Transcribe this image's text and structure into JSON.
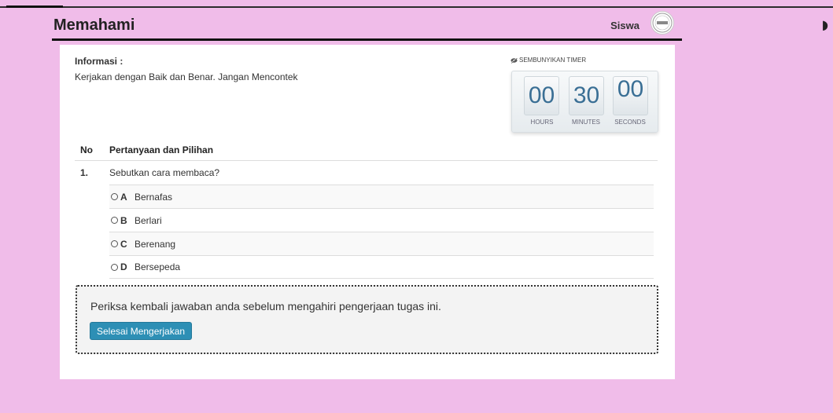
{
  "header": {
    "title": "Memahami",
    "user": "Siswa",
    "right_glyph": "›"
  },
  "info": {
    "title": "Informasi :",
    "text": "Kerjakan dengan Baik dan Benar. Jangan Mencontek"
  },
  "timer": {
    "hide_label": "SEMBUNYIKAN TIMER",
    "hours": "00",
    "minutes": "30",
    "seconds": "00",
    "hours_label": "HOURS",
    "minutes_label": "MINUTES",
    "seconds_label": "SECONDS"
  },
  "table": {
    "col_no": "No",
    "col_question": "Pertanyaan dan Pilihan"
  },
  "question": {
    "number": "1.",
    "text": "Sebutkan cara membaca?",
    "options": [
      {
        "letter": "A",
        "text": "Bernafas"
      },
      {
        "letter": "B",
        "text": "Berlari"
      },
      {
        "letter": "C",
        "text": "Berenang"
      },
      {
        "letter": "D",
        "text": "Bersepeda"
      }
    ]
  },
  "notice": {
    "text": "Periksa kembali jawaban anda sebelum mengahiri pengerjaan tugas ini.",
    "button": "Selesai Mengerjakan"
  }
}
